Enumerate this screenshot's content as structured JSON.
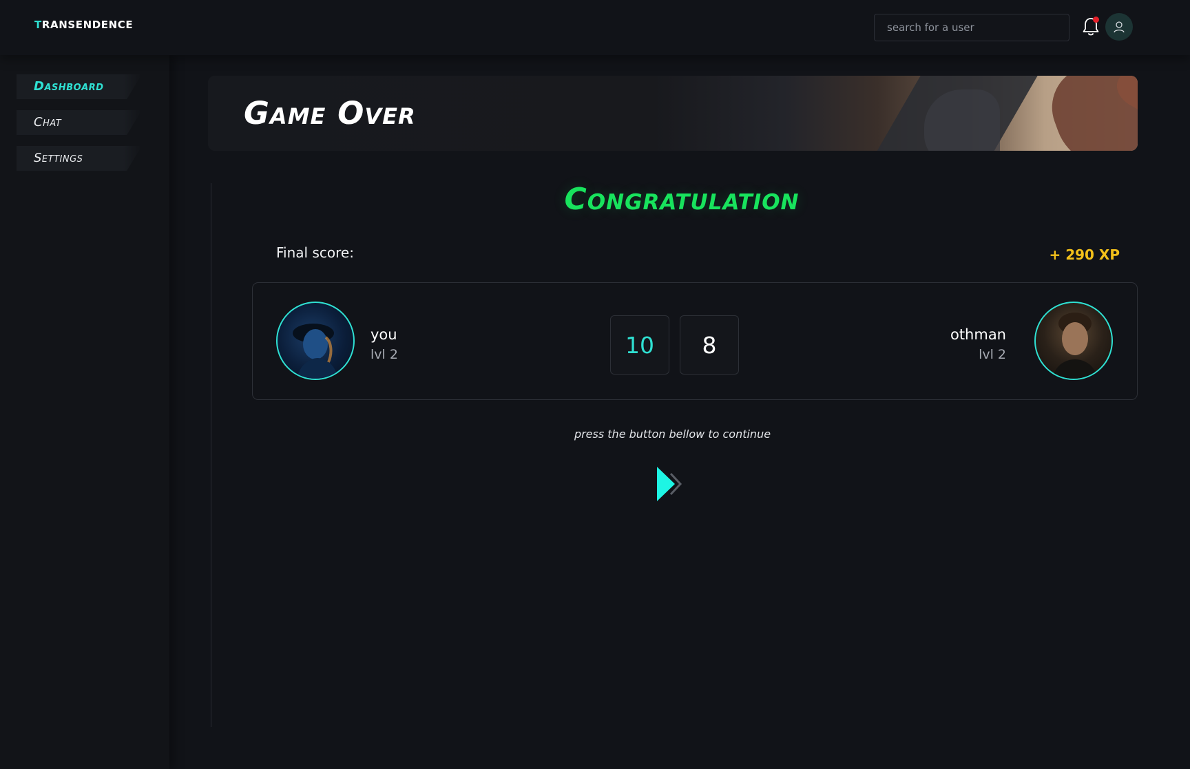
{
  "app": {
    "brand": "TRANSENDENCE",
    "brand_first_letter": "T",
    "brand_rest": "RANSENDENCE"
  },
  "header": {
    "search_placeholder": "search for a user",
    "notification_icon": "bell-icon",
    "profile_icon": "user-icon"
  },
  "sidebar": {
    "items": [
      {
        "label": "Dashboard",
        "active": true
      },
      {
        "label": "Chat",
        "active": false
      },
      {
        "label": "Settings",
        "active": false
      }
    ]
  },
  "banner": {
    "title": "Game Over"
  },
  "result": {
    "headline": "Congratulation",
    "final_score_label": "Final score:",
    "xp_gain": "+ 290 XP"
  },
  "players": {
    "left": {
      "name": "you",
      "level": "lvl 2",
      "score": "10"
    },
    "right": {
      "name": "othman",
      "level": "lvl 2",
      "score": "8"
    }
  },
  "continue": {
    "hint": "press the button bellow to continue",
    "icon": "double-chevron-right-icon"
  },
  "colors": {
    "accent": "#2fe0d2",
    "success": "#18e35d",
    "xp": "#f3c01a",
    "background": "#111318",
    "notification_dot": "#e4202a"
  }
}
